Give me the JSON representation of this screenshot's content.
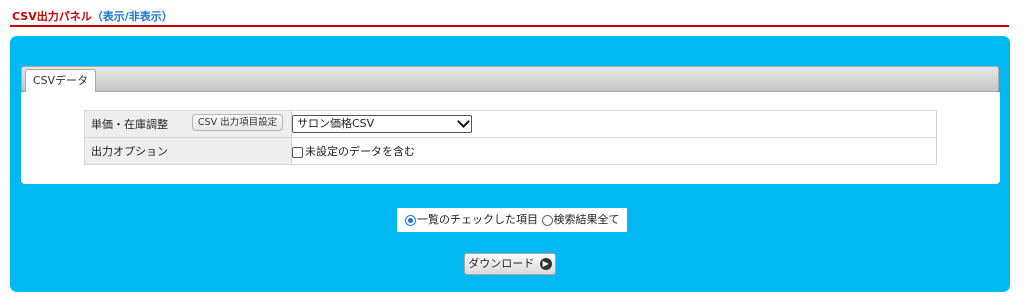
{
  "header": {
    "title": "CSV出力パネル",
    "toggle_open": "（",
    "toggle_label": "表示/非表示",
    "toggle_close": "）"
  },
  "tabs": [
    {
      "label": "CSVデータ",
      "active": true
    }
  ],
  "settings": {
    "row1_label": "単価・在庫調整",
    "row1_button": "CSV 出力項目設定",
    "row1_select_value": "サロン価格CSV",
    "row2_label": "出力オプション",
    "row2_checkbox_label": "未設定のデータを含む",
    "row2_checked": false
  },
  "scope": {
    "option1": "一覧のチェックした項目",
    "option2": "検索結果全て",
    "selected": "option1"
  },
  "download": {
    "label": "ダウンロード",
    "icon": "arrow-right-circle-icon"
  },
  "colors": {
    "header_title": "#cc0000",
    "toggle_link": "#1a75cf",
    "panel_background": "#00b9f2",
    "radio_selected": "#1a73e8"
  }
}
